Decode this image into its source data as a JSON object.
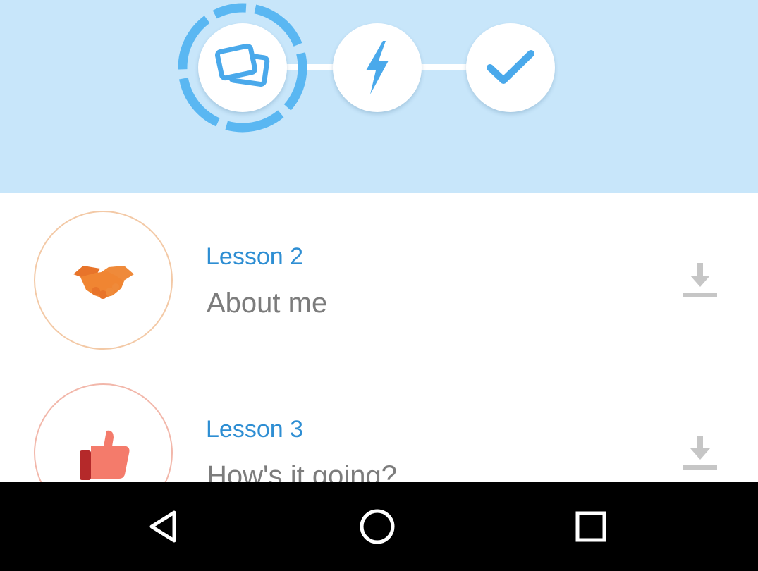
{
  "colors": {
    "header_bg": "#c8e6fa",
    "accent_blue": "#5ab7f2",
    "lesson_title": "#2e8ed3",
    "lesson_subtitle": "#7c7c7c",
    "download_icon": "#c6c6c6",
    "nav_bg": "#000000"
  },
  "progress": {
    "steps": [
      {
        "icon": "flashcards-icon",
        "state": "current",
        "ring_progress": 0.8
      },
      {
        "icon": "lightning-icon",
        "state": "pending"
      },
      {
        "icon": "checkmark-icon",
        "state": "pending"
      }
    ]
  },
  "lessons": [
    {
      "title": "Lesson 2",
      "subtitle": "About me",
      "icon": "handshake-icon",
      "ring_color": "#f3c9a6",
      "action_icon": "download-icon"
    },
    {
      "title": "Lesson 3",
      "subtitle": "How's it going?",
      "icon": "thumbs-up-icon",
      "ring_color": "#f2b7aa",
      "action_icon": "download-icon"
    }
  ],
  "nav": {
    "buttons": [
      {
        "name": "back",
        "icon": "back-triangle-icon"
      },
      {
        "name": "home",
        "icon": "home-circle-icon"
      },
      {
        "name": "recents",
        "icon": "recents-square-icon"
      }
    ]
  }
}
